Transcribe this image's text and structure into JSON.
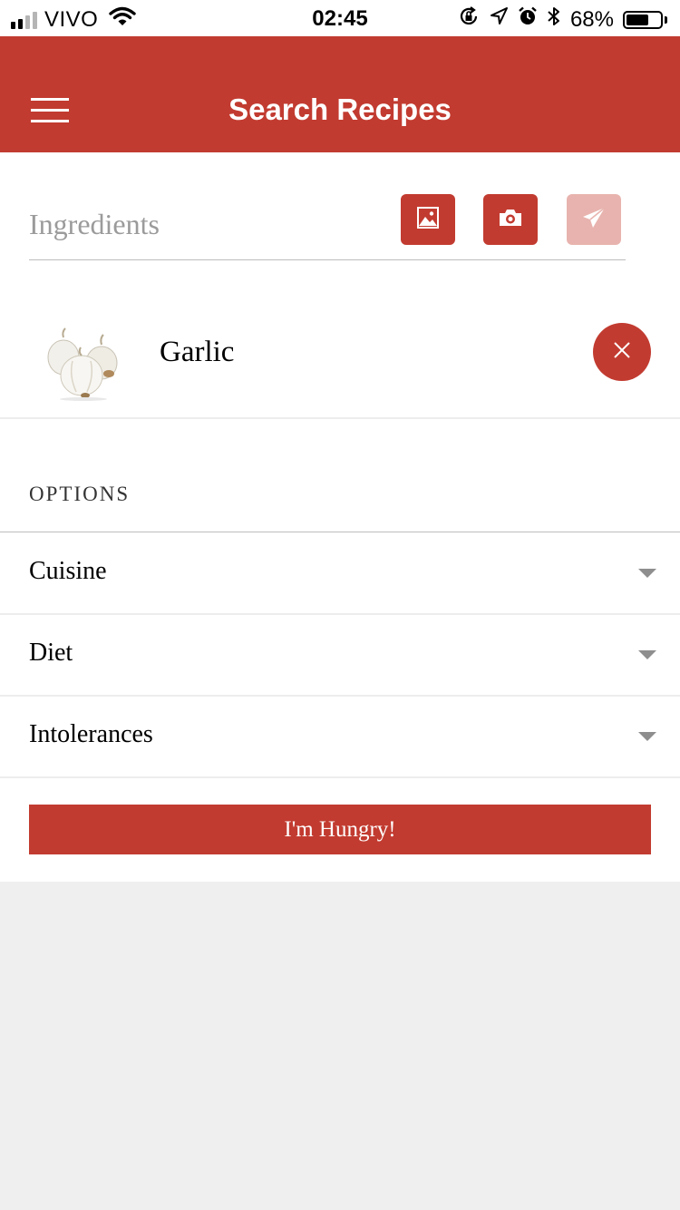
{
  "status_bar": {
    "carrier": "VIVO",
    "time": "02:45",
    "battery_percent": "68%",
    "battery_level": 0.68,
    "signal_bars": 4,
    "signal_bars_filled": 2,
    "icons": [
      "signal-icon",
      "wifi-icon",
      "rotation-lock-icon",
      "location-icon",
      "alarm-icon",
      "bluetooth-icon",
      "battery-icon"
    ]
  },
  "navbar": {
    "title": "Search Recipes",
    "menu_icon": "hamburger-menu-icon",
    "background": "#c23b30"
  },
  "ingredients": {
    "placeholder": "Ingredients",
    "value": "",
    "buttons": [
      {
        "icon": "image-icon",
        "enabled": true
      },
      {
        "icon": "camera-icon",
        "enabled": true
      },
      {
        "icon": "send-icon",
        "enabled": false
      }
    ],
    "items": [
      {
        "name": "Garlic",
        "image": "garlic-image",
        "remove_icon": "close-icon"
      }
    ]
  },
  "options": {
    "header": "OPTIONS",
    "rows": [
      {
        "label": "Cuisine",
        "icon": "chevron-down-icon"
      },
      {
        "label": "Diet",
        "icon": "chevron-down-icon"
      },
      {
        "label": "Intolerances",
        "icon": "chevron-down-icon"
      }
    ]
  },
  "submit_label": "I'm Hungry!",
  "colors": {
    "accent": "#c23b30",
    "accent_disabled": "#e8b3ae",
    "page_background": "#efefef"
  }
}
